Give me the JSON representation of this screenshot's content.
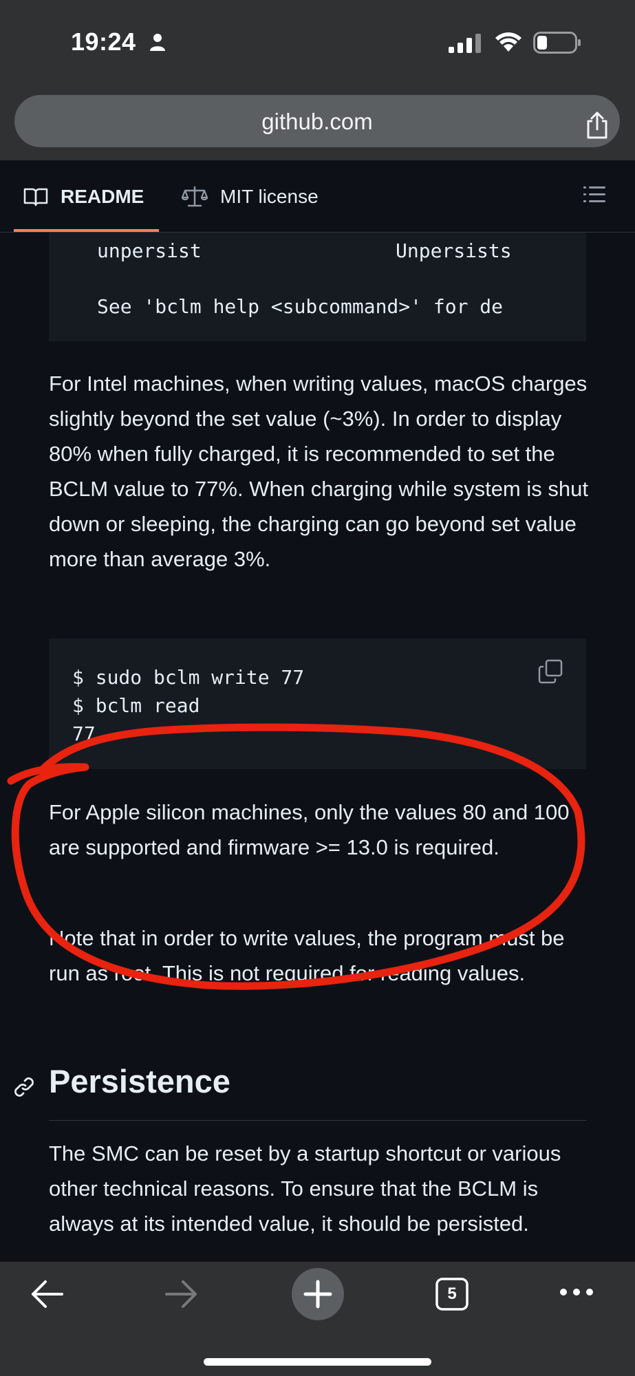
{
  "status_bar": {
    "time": "19:24"
  },
  "browser": {
    "url": "github.com",
    "tab_count": "5"
  },
  "repo_tabs": {
    "readme": "README",
    "license": "MIT license"
  },
  "code_block_1": {
    "line1_cmd": "unpersist",
    "line1_desc": "Unpersists",
    "line2": "See 'bclm help <subcommand>' for de"
  },
  "para_intel": "For Intel machines, when writing values, macOS charges slightly beyond the set value (~3%). In order to display 80% when fully charged, it is recommended to set the BCLM value to 77%. When charging while system is shut down or sleeping, the charging can go beyond set value more than average 3%.",
  "code_block_2": {
    "lines": "$ sudo bclm write 77\n$ bclm read\n77"
  },
  "para_apple": "For Apple silicon machines, only the values 80 and 100 are supported and firmware >= 13.0 is required.",
  "para_root": "Note that in order to write values, the program must be run as root. This is not required for reading values.",
  "heading_persistence": "Persistence",
  "para_smc": "The SMC can be reset by a startup shortcut or various other technical reasons. To ensure that the BCLM is always at its intended value, it should be persisted.",
  "colors": {
    "annotation": "#e8230f",
    "tab_underline": "#f78166",
    "chrome": "#2f3133"
  }
}
